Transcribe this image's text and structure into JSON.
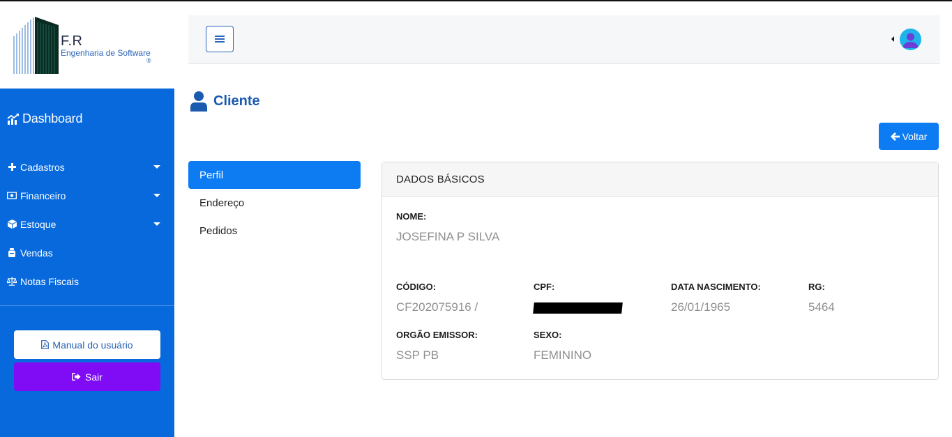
{
  "brand": {
    "name": "F.R",
    "subtitle": "Engenharia de Software",
    "registered": "®"
  },
  "sidebar": {
    "dashboard": "Dashboard",
    "items": [
      {
        "label": "Cadastros",
        "icon": "plus-icon",
        "has_submenu": true
      },
      {
        "label": "Financeiro",
        "icon": "money-icon",
        "has_submenu": true
      },
      {
        "label": "Estoque",
        "icon": "cube-icon",
        "has_submenu": true
      },
      {
        "label": "Vendas",
        "icon": "money-bag-icon",
        "has_submenu": false
      },
      {
        "label": "Notas Fiscais",
        "icon": "scale-icon",
        "has_submenu": false
      }
    ],
    "manual_label": "Manual do usuário",
    "logout_label": "Sair"
  },
  "page": {
    "title": "Cliente",
    "back_label": "Voltar"
  },
  "tabs": [
    {
      "label": "Perfil",
      "active": true
    },
    {
      "label": "Endereço",
      "active": false
    },
    {
      "label": "Pedidos",
      "active": false
    }
  ],
  "card": {
    "header": "DADOS BÁSICOS",
    "nome_label": "NOME:",
    "nome_value": "JOSEFINA P SILVA",
    "codigo_label": "CÓDIGO:",
    "codigo_value": "CF202075916 /",
    "cpf_label": "CPF:",
    "data_label": "DATA NASCIMENTO:",
    "data_value": "26/01/1965",
    "rg_label": "RG:",
    "rg_value": "5464",
    "orgao_label": "ORGÃO EMISSOR:",
    "orgao_value": "SSP PB",
    "sexo_label": "SEXO:",
    "sexo_value": "FEMININO"
  },
  "colors": {
    "sidebar": "#0769dc",
    "primary": "#0d7cf2",
    "logout": "#7f0cf5",
    "title": "#1a5bb0"
  }
}
